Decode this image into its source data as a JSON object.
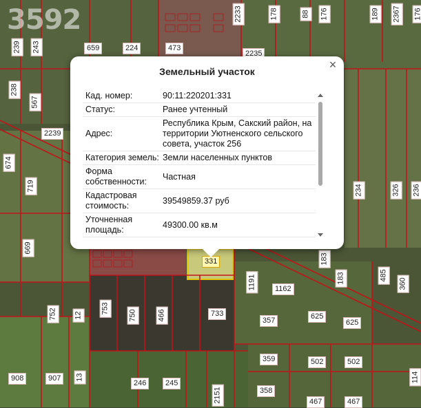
{
  "watermark": "3592",
  "popup": {
    "title": "Земельный участок",
    "close_glyph": "×",
    "rows": [
      {
        "key": "Кад. номер:",
        "value": "90:11:220201:331"
      },
      {
        "key": "Статус:",
        "value": "Ранее учтенный"
      },
      {
        "key": "Адрес:",
        "value": "Республика Крым, Сакский район, на территории Уютненского сельского совета, участок 256"
      },
      {
        "key": "Категория земель:",
        "value": "Земли населенных пунктов"
      },
      {
        "key": "Форма собственности:",
        "value": "Частная"
      },
      {
        "key": "Кадастровая стоимость:",
        "value": "39549859.37 руб"
      },
      {
        "key": "Уточненная площадь:",
        "value": "49300.00 кв.м"
      }
    ]
  },
  "map": {
    "selected_plot": "331",
    "plot_labels": [
      "239",
      "243",
      "659",
      "224",
      "473",
      "2233",
      "178",
      "88",
      "176",
      "189",
      "2367",
      "176",
      "238",
      "567",
      "2235",
      "2239",
      "674",
      "719",
      "669",
      "234",
      "326",
      "236",
      "1191",
      "1162",
      "183",
      "183",
      "485",
      "360",
      "753",
      "750",
      "466",
      "733",
      "357",
      "625",
      "625",
      "752",
      "12",
      "359",
      "502",
      "502",
      "908",
      "907",
      "13",
      "246",
      "245",
      "2151",
      "358",
      "467",
      "467",
      "114"
    ]
  }
}
